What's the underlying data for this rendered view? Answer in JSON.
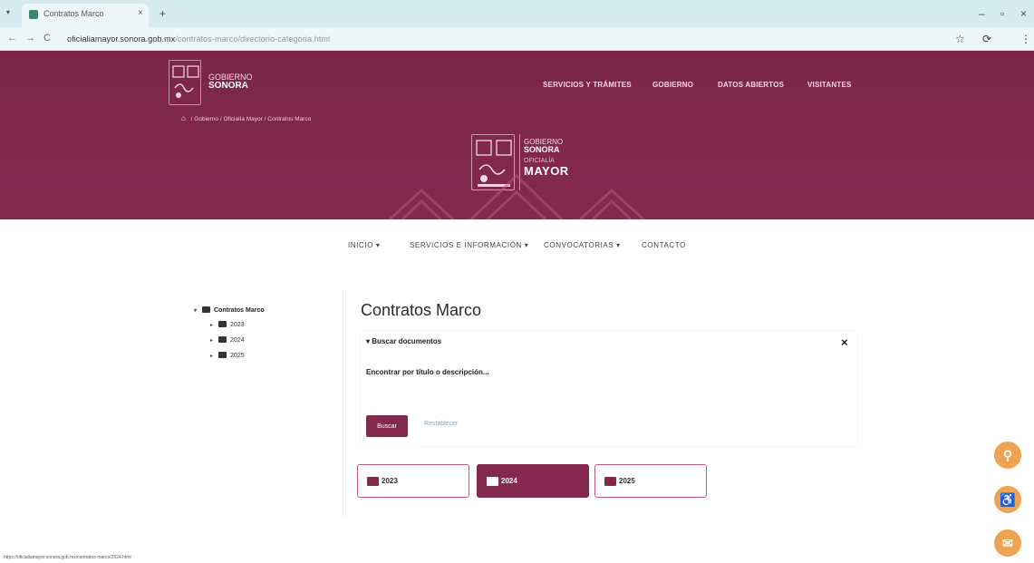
{
  "browser": {
    "tab_title": "Contratos Marco",
    "tab_close": "×",
    "new_tab": "+",
    "tab_menu": "▾",
    "url_main": "oficialiamayor.sonora.gob.mx",
    "url_rest": "/contratos-marco/directorio-categoria.html",
    "back": "←",
    "forward": "→",
    "reload": "C",
    "star": "☆",
    "ext": "⟳",
    "menu": "⋮",
    "minimize": "–",
    "restore": "▫",
    "close": "×"
  },
  "header": {
    "logo_gobierno": "GOBIERNO",
    "logo_sonora": "SONORA",
    "nav": [
      "SERVICIOS Y TRÁMITES",
      "GOBIERNO",
      "DATOS ABIERTOS",
      "VISITANTES"
    ],
    "breadcrumb": [
      "Gobierno",
      "Oficialía Mayor",
      "Contratos Marco"
    ],
    "breadcrumb_sep": "/",
    "home_icon": "⌂",
    "emblem_gobierno": "GOBIERNO",
    "emblem_sonora": "SONORA",
    "emblem_oficialia": "OFICIALÍA",
    "emblem_mayor": "MAYOR"
  },
  "subnav": [
    "INICIO ▾",
    "SERVICIOS E INFORMACIÓN ▾",
    "CONVOCATORIAS ▾",
    "CONTACTO"
  ],
  "sidebar": {
    "root": "Contratos Marco",
    "root_caret": "▾",
    "items": [
      {
        "label": "2023",
        "caret": "▸"
      },
      {
        "label": "2024",
        "caret": "▸"
      },
      {
        "label": "2025",
        "caret": "▸"
      }
    ]
  },
  "main": {
    "title": "Contratos Marco",
    "search_toggle": "▾ Buscar documentos",
    "close_x": "×",
    "search_label": "Encontrar por título o descripción...",
    "search_value": "",
    "buscar": "Buscar",
    "reset": "Restablecer",
    "years": [
      "2023",
      "2024",
      "2025"
    ],
    "active_year": "2024"
  },
  "floating": {
    "search": "⚲",
    "accessibility": "♿",
    "feedback": "✉"
  },
  "status_url": "https://oficialiamayor.sonora.gob.mx/contratos-marco/2024.html",
  "colors": {
    "brand": "#84294d",
    "accent": "#f0a350",
    "link": "#7fa6c8"
  }
}
